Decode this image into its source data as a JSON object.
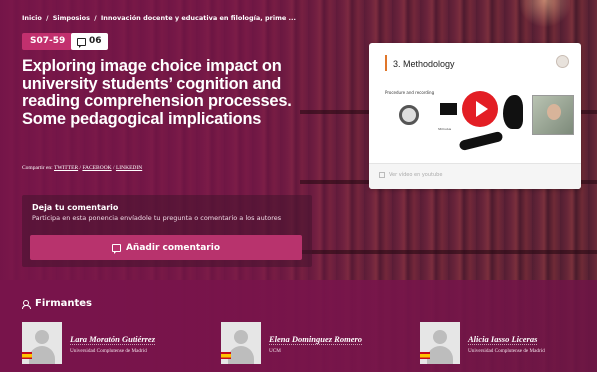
{
  "breadcrumb": {
    "home": "Inicio",
    "section": "Simposios",
    "current": "Innovación docente y educativa en filología, prime ..."
  },
  "tags": {
    "code": "S07-59",
    "comment_count": "06"
  },
  "title": "Exploring image choice impact on university students’ cognition and reading comprehension processes. Some pedagogical implications",
  "share": {
    "label": "Compartir en:",
    "twitter": "TWITTER",
    "facebook": "FACEBOOK",
    "linkedin": "LINKEDIN"
  },
  "video": {
    "slide_title": "3. Methodology",
    "slide_subtitle": "Procedure and recording",
    "monitor_label": "Stimulus",
    "link_label": "Ver vídeo en youtube"
  },
  "comment": {
    "title": "Deja tu comentario",
    "description": "Participa en esta ponencia envíadole tu pregunta o comentario a los autores",
    "button_label": "Añadir comentario"
  },
  "signers": {
    "title": "Firmantes",
    "items": [
      {
        "name": "Lara Moratón Gutiérrez",
        "affiliation": "Universidad Complutense de Madrid"
      },
      {
        "name": "Elena Dominguez Romero",
        "affiliation": "UCM"
      },
      {
        "name": "Alicia Iasso Liceras",
        "affiliation": "Universidad Complutense de Madrid"
      }
    ]
  },
  "colors": {
    "accent": "#b8336d",
    "tag": "#c2306e",
    "overlay": "#78144b",
    "play": "#e31e24"
  }
}
